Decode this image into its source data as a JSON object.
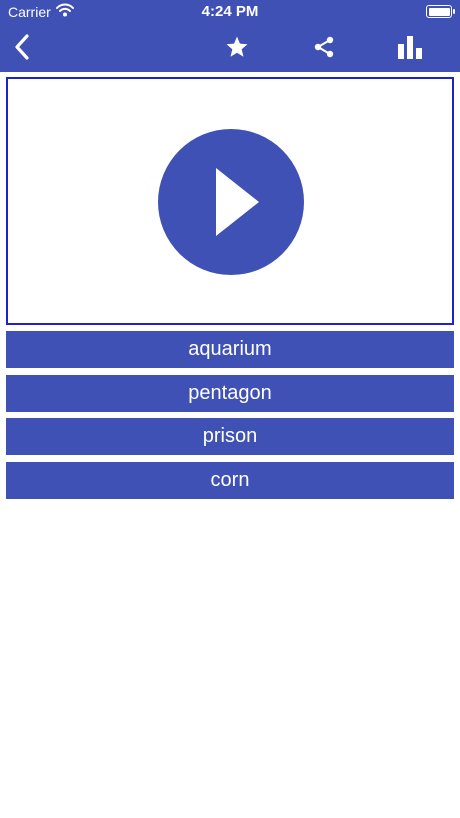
{
  "status_bar": {
    "carrier": "Carrier",
    "time": "4:24 PM",
    "wifi_icon": "wifi-icon",
    "battery_icon": "battery-icon"
  },
  "navbar": {
    "background": "#3f51b5",
    "icons": [
      "back-chevron-icon",
      "star-icon",
      "share-icon",
      "bar-chart-icon"
    ]
  },
  "media": {
    "play_icon": "play-icon",
    "border_color": "#1c23c8",
    "button_color": "#3f51b5"
  },
  "answers": [
    {
      "label": "aquarium"
    },
    {
      "label": "pentagon"
    },
    {
      "label": "prison"
    },
    {
      "label": "corn"
    }
  ]
}
